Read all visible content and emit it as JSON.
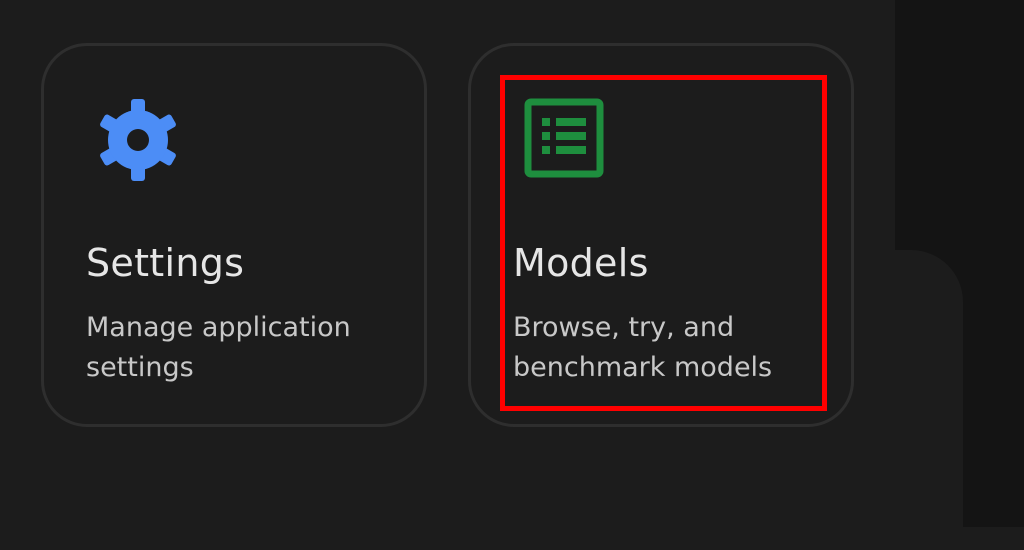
{
  "cards": {
    "settings": {
      "icon": "gear-icon",
      "title": "Settings",
      "description": "Manage application settings",
      "icon_color": "#4c8df6"
    },
    "models": {
      "icon": "list-document-icon",
      "title": "Models",
      "description": "Browse, try, and benchmark models",
      "icon_color": "#1e8e3e"
    }
  },
  "highlight": {
    "target": "models card",
    "color": "#ff0000"
  },
  "colors": {
    "background": "#1c1c1c",
    "card_border": "#2e2e2e",
    "side_background": "#141414"
  }
}
